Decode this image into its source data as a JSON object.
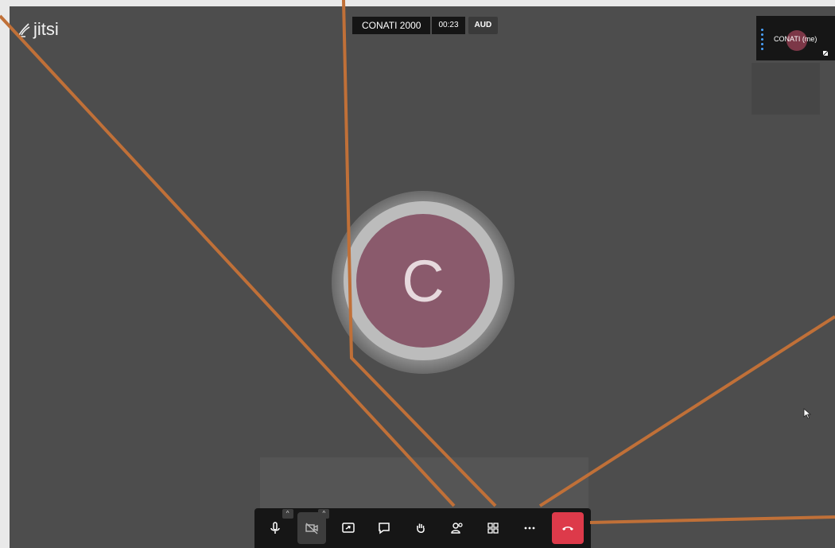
{
  "app": {
    "logo_text": "jitsi"
  },
  "meeting": {
    "conference_name": "CONATI 2000",
    "timer": "00:23",
    "aud_label": "AUD"
  },
  "participants": {
    "local_name": "CONATI (me)",
    "main_avatar_initial": "C"
  },
  "toolbar": {
    "buttons": [
      {
        "name": "microphone-button",
        "icon": "mic-icon"
      },
      {
        "name": "camera-button",
        "icon": "camera-off-icon"
      },
      {
        "name": "share-screen-button",
        "icon": "screen-share-icon"
      },
      {
        "name": "chat-button",
        "icon": "chat-icon"
      },
      {
        "name": "raise-hand-button",
        "icon": "hand-icon"
      },
      {
        "name": "participants-button",
        "icon": "participants-icon"
      },
      {
        "name": "tile-view-button",
        "icon": "grid-icon"
      },
      {
        "name": "more-actions-button",
        "icon": "more-icon"
      },
      {
        "name": "hangup-button",
        "icon": "hangup-icon"
      }
    ],
    "caret_symbol": "^",
    "hangup_color": "#dd3a4a"
  },
  "colors": {
    "stage_bg": "#4d4d4d",
    "avatar_bg": "#8a5a6c",
    "annotation_line": "#c07038"
  }
}
